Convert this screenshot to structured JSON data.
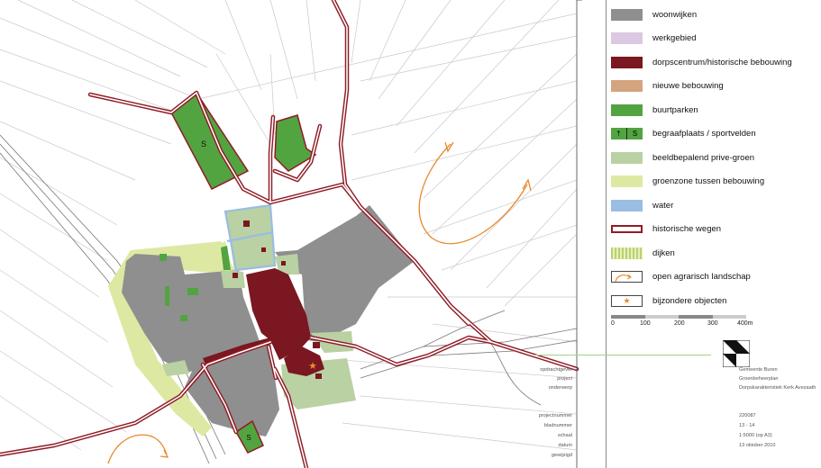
{
  "map": {
    "parcel_labels": [
      "S",
      "S"
    ],
    "colors": {
      "residential": "#8f8f8f",
      "work": "#dcc8e2",
      "village_centre": "#7a1720",
      "new_buildings": "#d4a47f",
      "parks": "#52a440",
      "private_green": "#b9d1a3",
      "buffer_green": "#dde9a3",
      "water": "#99bde3",
      "historic_roads": "#8f1c26",
      "arrows": "#e8892c"
    }
  },
  "legend": {
    "items": [
      {
        "label": "woonwijken",
        "type": "fill",
        "color": "#8f8f8f"
      },
      {
        "label": "werkgebied",
        "type": "fill",
        "color": "#dcc8e2"
      },
      {
        "label": "dorpscentrum/historische bebouwing",
        "type": "fill",
        "color": "#7a1720"
      },
      {
        "label": "nieuwe bebouwing",
        "type": "fill",
        "color": "#d4a47f"
      },
      {
        "label": "buurtparken",
        "type": "fill",
        "color": "#52a440"
      },
      {
        "label": "begraafplaats / sportvelden",
        "type": "cemetery",
        "color": "#52a440"
      },
      {
        "label": "beeldbepalend prive-groen",
        "type": "fill",
        "color": "#b9d1a3"
      },
      {
        "label": "groenzone tussen bebouwing",
        "type": "fill",
        "color": "#dde9a3"
      },
      {
        "label": "water",
        "type": "fill",
        "color": "#99bde3"
      },
      {
        "label": "historische wegen",
        "type": "road",
        "color": "#8f1c26"
      },
      {
        "label": "dijken",
        "type": "dike",
        "color": "#b9d36a"
      },
      {
        "label": "open agrarisch landschap",
        "type": "arrow",
        "color": "#e8892c"
      },
      {
        "label": "bijzondere objecten",
        "type": "star",
        "color": "#e8892c"
      }
    ],
    "cemetery_symbols": [
      "†",
      "S"
    ]
  },
  "scale": {
    "ticks": [
      "0",
      "100",
      "200",
      "300",
      "400m"
    ]
  },
  "title_block": {
    "fields": [
      {
        "key": "opdrachtgever",
        "value": "Gemeente Buren"
      },
      {
        "key": "project",
        "value": "Groenbeheerplan"
      },
      {
        "key": "onderwerp",
        "value": "Dorpskarakteristiek Kerk Avezaath"
      },
      {
        "key": "",
        "value": ""
      },
      {
        "key": "projectnummer",
        "value": "220087"
      },
      {
        "key": "bladnummer",
        "value": "13 - 14"
      },
      {
        "key": "schaal",
        "value": "1:5000 (op A3)"
      },
      {
        "key": "datum",
        "value": "13 oktober 2010"
      },
      {
        "key": "gewijzigd",
        "value": ""
      }
    ]
  }
}
